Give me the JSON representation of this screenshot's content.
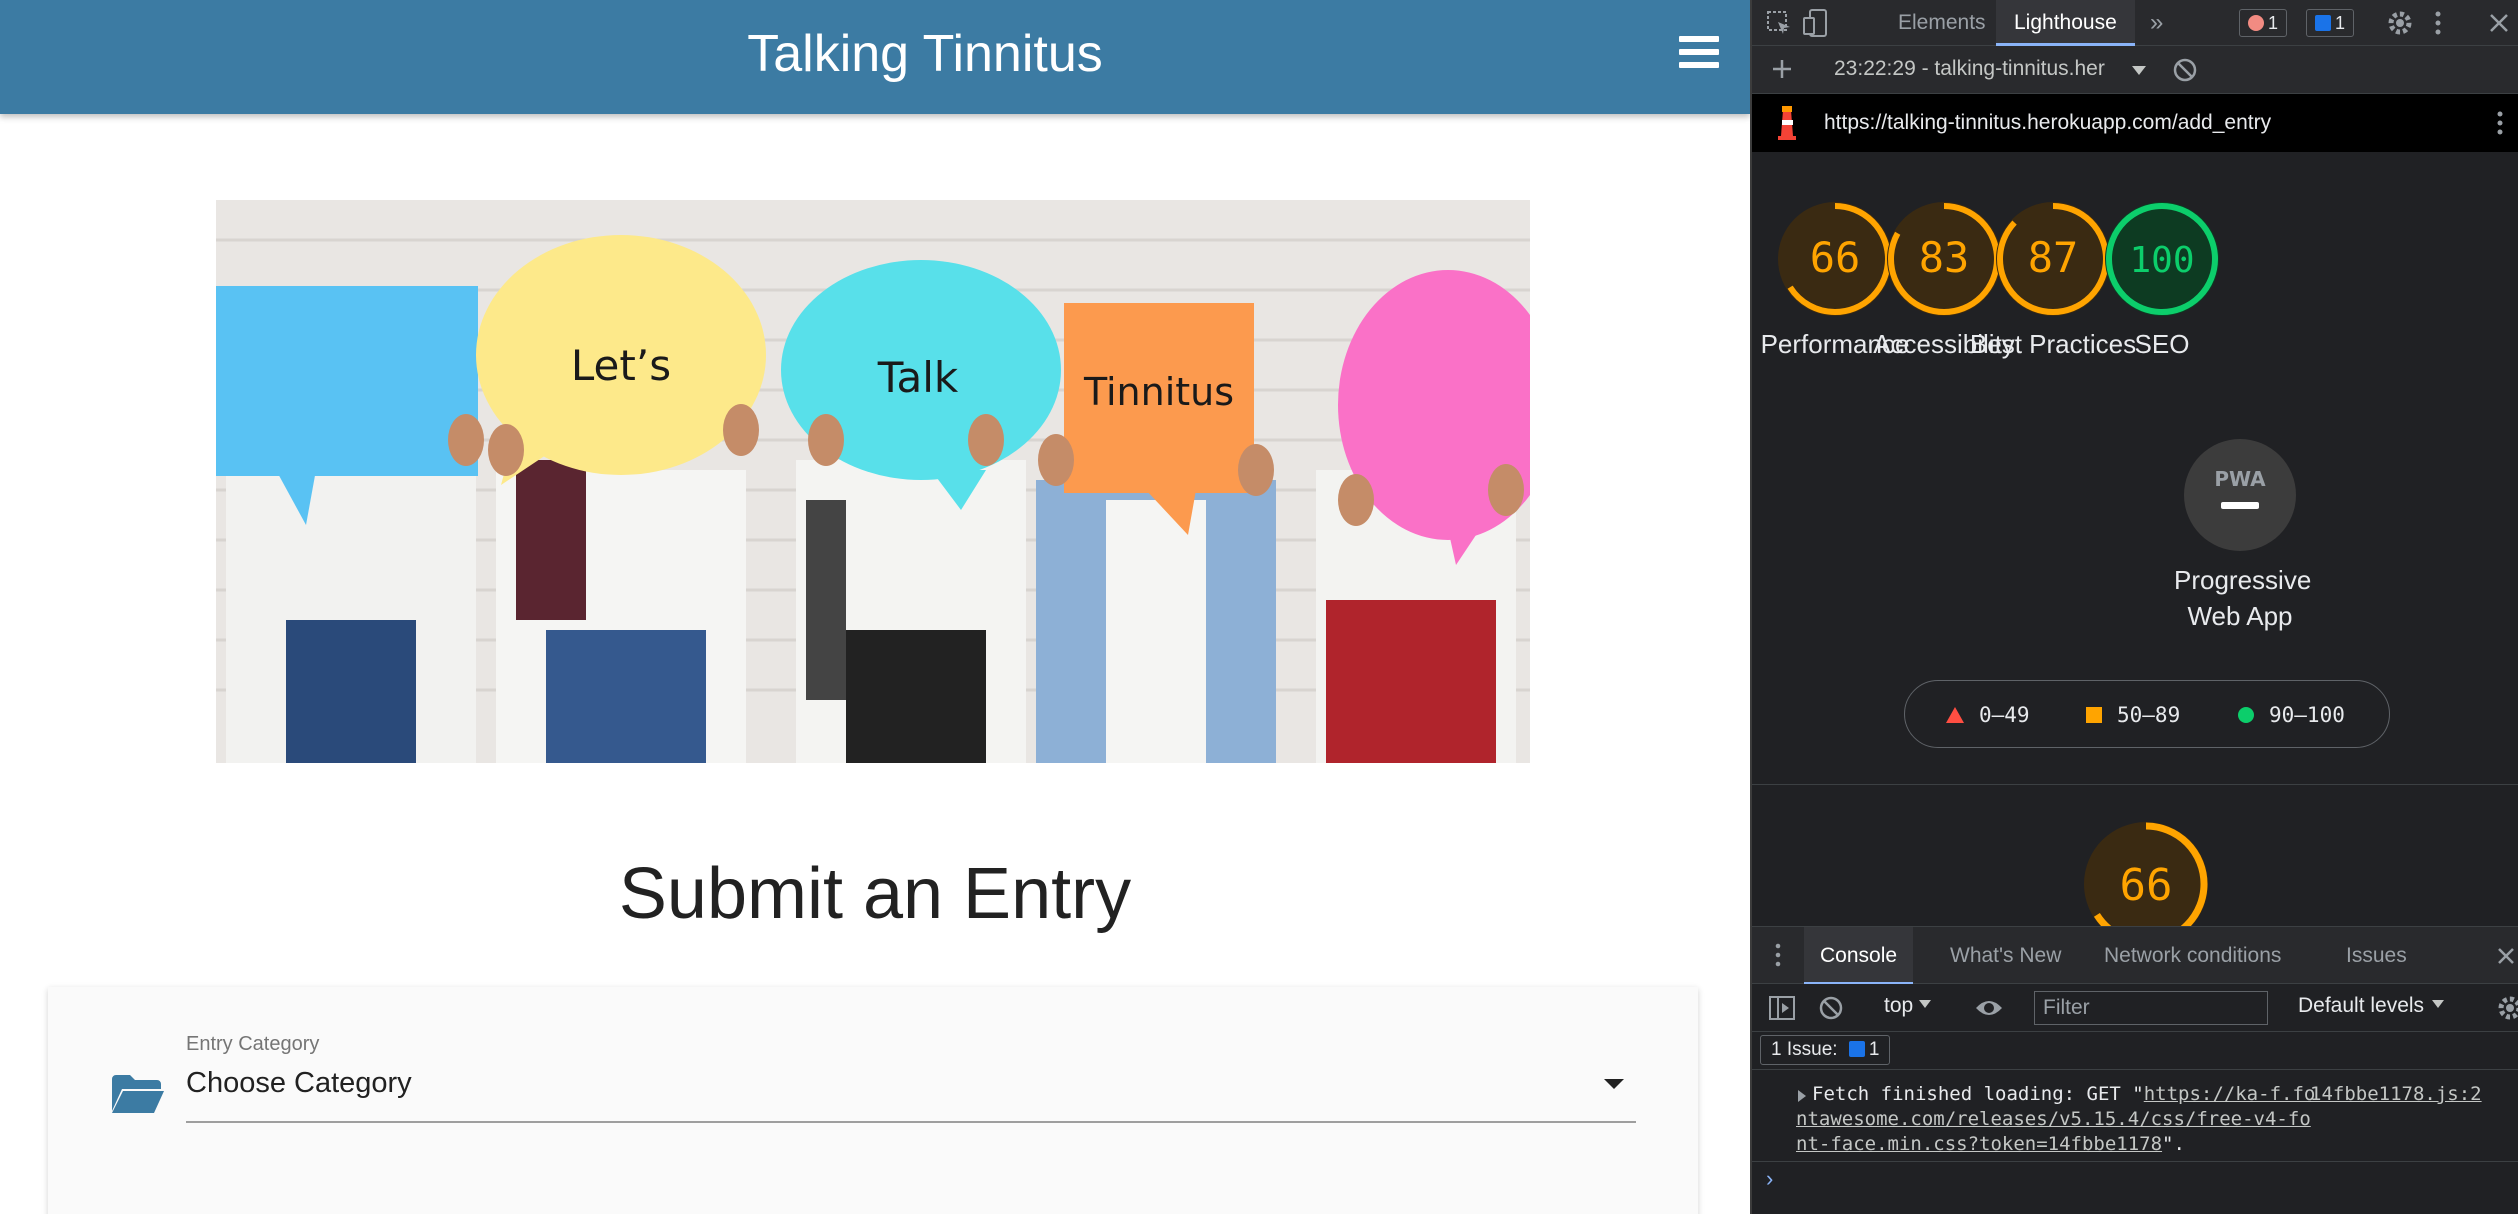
{
  "site": {
    "title": "Talking Tinnitus",
    "hero": {
      "bubble1": "Let’s",
      "bubble2": "Talk",
      "bubble3": "Tinnitus"
    },
    "page_heading": "Submit an Entry",
    "form": {
      "category_label": "Entry Category",
      "category_value": "Choose Category"
    }
  },
  "devtools": {
    "tabs": [
      "Elements",
      "Lighthouse"
    ],
    "more_tabs": "»",
    "error_count": "1",
    "message_count": "1",
    "report_select": "23:22:29 - talking-tinnitus.her",
    "url": "https://talking-tinnitus.herokuapp.com/add_entry",
    "scores": [
      {
        "label": "Performance",
        "value": 66,
        "color": "#ffa400"
      },
      {
        "label": "Accessibility",
        "value": 83,
        "color": "#ffa400"
      },
      {
        "label": "Best Practices",
        "value": 87,
        "color": "#ffa400"
      },
      {
        "label": "SEO",
        "value": 100,
        "color": "#0cce6b"
      }
    ],
    "pwa": {
      "badge": "PWA",
      "label": "Progressive Web App"
    },
    "legend": [
      {
        "range": "0–49",
        "color": "#ff4e42"
      },
      {
        "range": "50–89",
        "color": "#ffa400"
      },
      {
        "range": "90–100",
        "color": "#0cce6b"
      }
    ],
    "bottom_score": 66,
    "drawer_tabs": [
      "Console",
      "What's New",
      "Network conditions",
      "Issues"
    ],
    "context": "top",
    "filter_placeholder": "Filter",
    "levels": "Default levels",
    "issues_label": "1 Issue:",
    "issues_count": "1",
    "console_message": {
      "prefix": "Fetch finished loading: GET \"",
      "link": "https://ka-f.fontawesome.com/releases/v5.15.4/css/free-v4-font-face.min.css?token=14fbbe1178",
      "suffix": "\".",
      "source": "14fbbe1178.js:2"
    },
    "prompt": "›"
  }
}
